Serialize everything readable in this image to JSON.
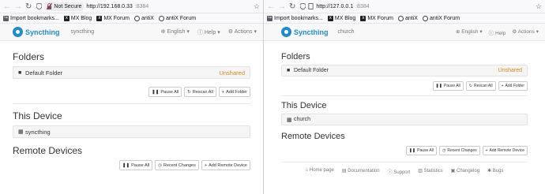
{
  "left": {
    "url": {
      "security": "Not Secure",
      "host": "http://192.168.0.33",
      "port": ":8384"
    },
    "bookmarks": [
      "Import bookmarks...",
      "MX Blog",
      "MX Forum",
      "antiX",
      "antiX Forum"
    ],
    "nav": {
      "brand": "Syncthing",
      "device": "syncthing",
      "language": "English",
      "help": "Help",
      "actions": "Actions"
    },
    "folders_title": "Folders",
    "folder": {
      "name": "Default Folder",
      "status": "Unshared"
    },
    "folder_buttons": {
      "pause": "Pause All",
      "rescan": "Rescan All",
      "add": "Add Folder"
    },
    "this_device_title": "This Device",
    "this_device": "syncthing",
    "remote_title": "Remote Devices",
    "remote_buttons": {
      "pause": "Pause All",
      "changes": "Recent Changes",
      "add": "Add Remote Device"
    }
  },
  "right": {
    "url": {
      "host": "http://127.0.0.1",
      "port": ":8384"
    },
    "bookmarks": [
      "Import bookmarks...",
      "MX Blog",
      "MX Forum",
      "antiX",
      "antiX Forum"
    ],
    "nav": {
      "brand": "Syncthing",
      "device": "church",
      "language": "English",
      "help": "Help",
      "actions": "Actions"
    },
    "folders_title": "Folders",
    "folder": {
      "name": "Default Folder",
      "status": "Unshared"
    },
    "folder_buttons": {
      "pause": "Pause All",
      "rescan": "Rescan All",
      "add": "Add Folder"
    },
    "this_device_title": "This Device",
    "this_device": "church",
    "remote_title": "Remote Devices",
    "remote_buttons": {
      "pause": "Pause All",
      "changes": "Recent Changes",
      "add": "Add Remote Device"
    },
    "footer": [
      "Home page",
      "Documentation",
      "Support",
      "Statistics",
      "Changelog",
      "Bugs"
    ]
  },
  "colors": {
    "brand": "#1e8bd0",
    "unshared": "#d58512"
  },
  "icons": [
    "back-arrow-icon",
    "forward-arrow-icon",
    "reload-icon",
    "shield-icon",
    "lock-icon",
    "star-icon",
    "folder-icon",
    "pause-icon",
    "refresh-icon",
    "plus-icon",
    "qr-icon",
    "desktop-icon",
    "globe-icon",
    "question-icon",
    "gear-icon",
    "bookmark-icon"
  ]
}
